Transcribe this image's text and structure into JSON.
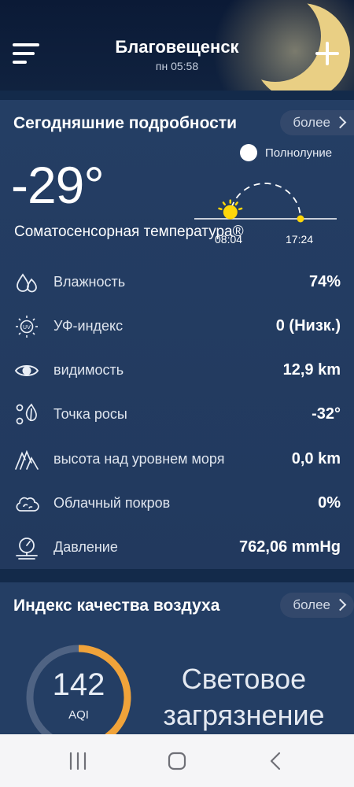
{
  "header": {
    "city": "Благовещенск",
    "time": "пн 05:58"
  },
  "details": {
    "title": "Сегодняшние подробности",
    "more_label": "более",
    "moon_phase": "Полнолуние",
    "temperature": "-29°",
    "feels_like_label": "Соматосенсорная температура®",
    "sunrise": "08:04",
    "sunset": "17:24",
    "sun_progress": 0.06,
    "rows": [
      {
        "label": "Влажность",
        "value": "74%",
        "icon": "humidity-icon"
      },
      {
        "label": "УФ-индекс",
        "value": "0 (Низк.)",
        "icon": "uv-index-icon"
      },
      {
        "label": "видимость",
        "value": "12,9 km",
        "icon": "visibility-eye-icon"
      },
      {
        "label": "Точка росы",
        "value": "-32°",
        "icon": "dew-point-icon"
      },
      {
        "label": "высота над уровнем моря",
        "value": "0,0 km",
        "icon": "altitude-icon"
      },
      {
        "label": "Облачный покров",
        "value": "0%",
        "icon": "cloud-cover-icon"
      },
      {
        "label": "Давление",
        "value": "762,06 mmHg",
        "icon": "pressure-gauge-icon"
      }
    ]
  },
  "air_quality": {
    "title": "Индекс качества воздуха",
    "more_label": "более",
    "aqi_value": "142",
    "aqi_unit": "AQI",
    "status": "Световое загрязнение",
    "ring_progress": 0.4
  },
  "colors": {
    "accent_orange": "#f0a33a",
    "sun_yellow": "#ffd60a",
    "card_bg": "#243e64",
    "page_bg": "#132a4a"
  }
}
